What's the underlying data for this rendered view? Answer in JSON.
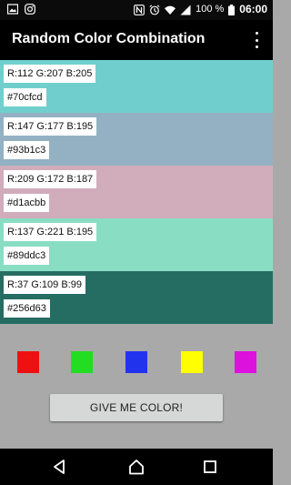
{
  "status_bar": {
    "left_icons": [
      "image-icon",
      "instagram-icon"
    ],
    "right_icons": [
      "nfc-icon",
      "alarm-icon",
      "wifi-icon",
      "signal-icon"
    ],
    "battery": "100 %",
    "time": "06:00"
  },
  "app_bar": {
    "title": "Random Color Combination",
    "menu_icon": "more-vert-icon"
  },
  "colors": [
    {
      "rgb": "R:112 G:207 B:205",
      "hex": "#70cfcd"
    },
    {
      "rgb": "R:147 G:177 B:195",
      "hex": "#93b1c3"
    },
    {
      "rgb": "R:209 G:172 B:187",
      "hex": "#d1acbb"
    },
    {
      "rgb": "R:137 G:221 B:195",
      "hex": "#89ddc3"
    },
    {
      "rgb": "R:37 G:109 B:99",
      "hex": "#256d63"
    }
  ],
  "swatches": [
    {
      "name": "red",
      "color": "#ee1111"
    },
    {
      "name": "green",
      "color": "#22dd22"
    },
    {
      "name": "blue",
      "color": "#2233ee"
    },
    {
      "name": "yellow",
      "color": "#ffff00"
    },
    {
      "name": "magenta",
      "color": "#dd11dd"
    }
  ],
  "button": {
    "label": "GIVE ME COLOR!"
  },
  "nav_bar": {
    "items": [
      "back-icon",
      "home-icon",
      "recents-icon"
    ]
  }
}
